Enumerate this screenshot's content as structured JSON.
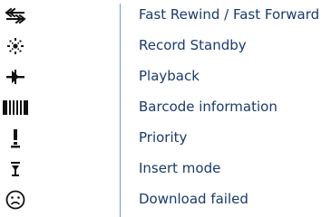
{
  "legend": {
    "items": [
      {
        "icon": "fast-rewind-fast-forward-icon",
        "label": "Fast Rewind / Fast Forward"
      },
      {
        "icon": "record-standby-icon",
        "label": "Record Standby"
      },
      {
        "icon": "playback-icon",
        "label": "Playback"
      },
      {
        "icon": "barcode-icon",
        "label": "Barcode information"
      },
      {
        "icon": "priority-icon",
        "label": "Priority"
      },
      {
        "icon": "insert-mode-icon",
        "label": "Insert mode"
      },
      {
        "icon": "download-failed-icon",
        "label": "Download failed"
      }
    ]
  }
}
